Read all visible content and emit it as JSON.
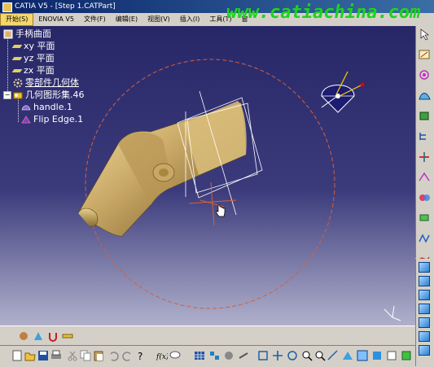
{
  "window": {
    "title": "CATIA V5 - [Step 1.CATPart]"
  },
  "watermark": "www.catiachina.com",
  "menu": [
    {
      "label": "开始(S)"
    },
    {
      "label": "ENOVIA V5"
    },
    {
      "label": "文件(F)"
    },
    {
      "label": "编辑(E)"
    },
    {
      "label": "视图(V)"
    },
    {
      "label": "插入(I)"
    },
    {
      "label": "工具(T)"
    },
    {
      "label": "窗"
    }
  ],
  "tree": {
    "root": "手柄曲面",
    "planes": [
      "xy 平面",
      "yz 平面",
      "zx 平面"
    ],
    "part_body": "零部件几何体",
    "geo_set": "几何图形集.46",
    "features": [
      "handle.1",
      "Flip Edge.1"
    ]
  },
  "colors": {
    "title_bar": "#0a246a",
    "viewport_top": "#272768",
    "viewport_bottom": "#b0b0cc",
    "part_surface": "#c9a866",
    "watermark": "#1ed21e",
    "compass_arc": "#d4603a"
  },
  "icons": {
    "right_toolbar": [
      "pointer-icon",
      "sketch-icon",
      "spiral-icon",
      "surface-icon",
      "fill-icon",
      "tree-icon",
      "split-icon",
      "trim-icon",
      "join-icon",
      "extract-icon",
      "offset-icon",
      "sweep-icon",
      "fillet-icon",
      "rotate-icon",
      "translate-icon",
      "symmetry-icon"
    ],
    "view_cubes": [
      "iso-view-icon",
      "front-view-icon",
      "back-view-icon",
      "left-view-icon",
      "right-view-icon",
      "top-view-icon",
      "bottom-view-icon"
    ],
    "bottom_row1": [
      "apply-material-icon",
      "rendering-icon",
      "magnet-icon",
      "measure-icon"
    ],
    "bottom_row2": [
      "new-icon",
      "open-icon",
      "save-icon",
      "print-icon",
      "cut-icon",
      "copy-icon",
      "paste-icon",
      "undo-icon",
      "redo-icon",
      "help-icon",
      "formula-icon",
      "knowledge-icon",
      "table-icon",
      "catalog-icon",
      "macro-icon",
      "fly-mode-icon",
      "fit-all-icon",
      "pan-icon",
      "rotate-view-icon",
      "zoom-in-icon",
      "zoom-out-icon",
      "normal-view-icon",
      "quick-view-icon",
      "multi-view-icon",
      "shading-icon",
      "hide-show-icon",
      "swap-space-icon"
    ]
  }
}
